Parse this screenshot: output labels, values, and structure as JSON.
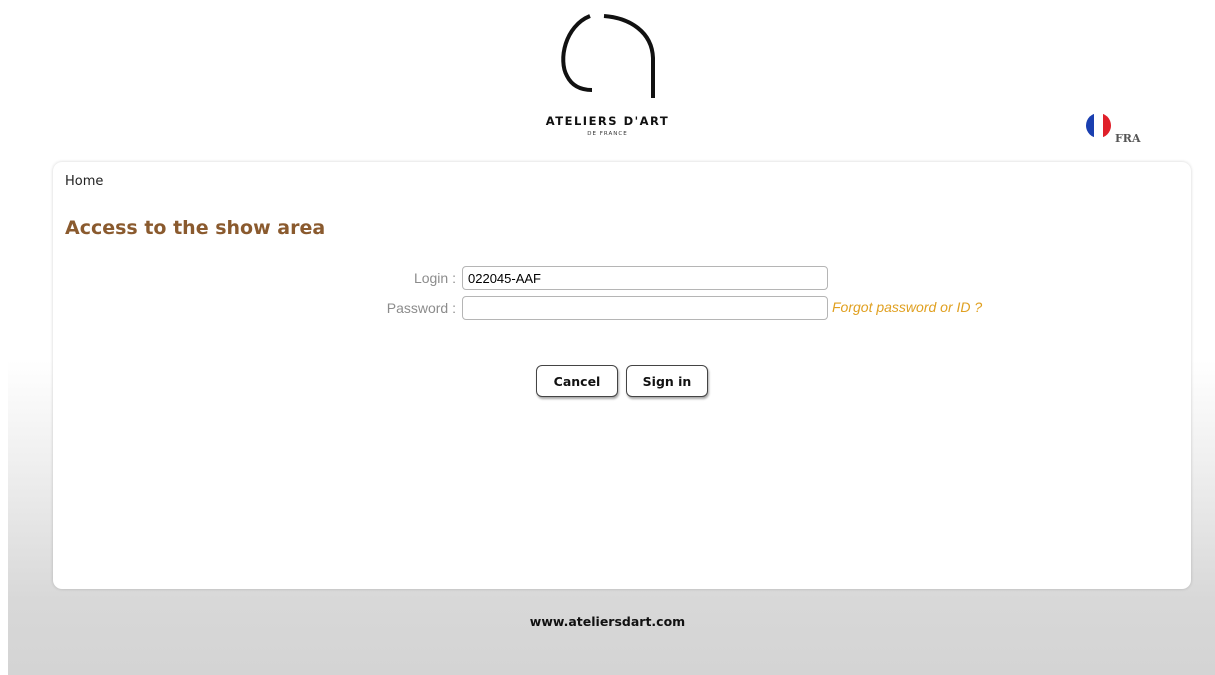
{
  "header": {
    "brand_name": "ATELIERS D'ART",
    "brand_sub": "DE FRANCE",
    "language": {
      "label": "FRA",
      "icon": "french-flag-icon",
      "colors": [
        "#1a3fb0",
        "#ffffff",
        "#e0202a"
      ]
    }
  },
  "breadcrumb": {
    "home": "Home"
  },
  "page": {
    "title": "Access to the show area",
    "title_color": "#8a5a2e"
  },
  "form": {
    "login": {
      "label": "Login :",
      "value": "022045-AAF",
      "placeholder": ""
    },
    "password": {
      "label": "Password :",
      "value": "",
      "placeholder": ""
    },
    "forgot_link": "Forgot password or ID ?",
    "forgot_color": "#e0a020",
    "cancel_label": "Cancel",
    "signin_label": "Sign in"
  },
  "footer": {
    "url": "www.ateliersdart.com"
  }
}
